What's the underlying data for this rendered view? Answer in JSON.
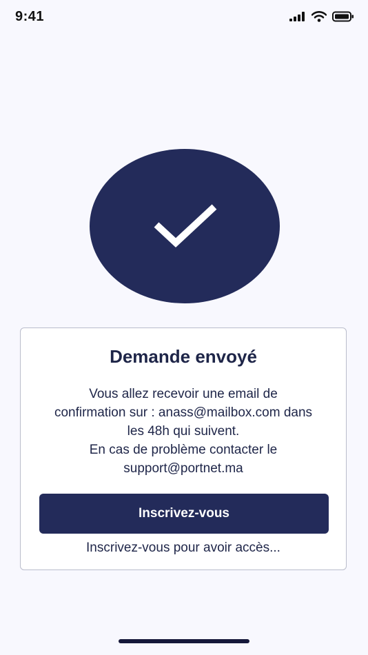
{
  "status_bar": {
    "time": "9:41",
    "icons": [
      "signal-icon",
      "wifi-icon",
      "battery-icon"
    ]
  },
  "success": {
    "icon": "checkmark-icon",
    "circle_color": "#232b5a"
  },
  "card": {
    "title": "Demande envoyé",
    "message_lines": [
      "Vous allez recevoir une email de",
      "confirmation sur : anass@mailbox.com dans",
      "les 48h qui suivent.",
      "En cas de problème contacter le",
      "support@portnet.ma"
    ],
    "button_label": "Inscrivez-vous",
    "hint": "Inscrivez-vous pour avoir accès..."
  },
  "colors": {
    "primary": "#232b5a",
    "background": "#f8f8fe",
    "text": "#1e2548"
  }
}
